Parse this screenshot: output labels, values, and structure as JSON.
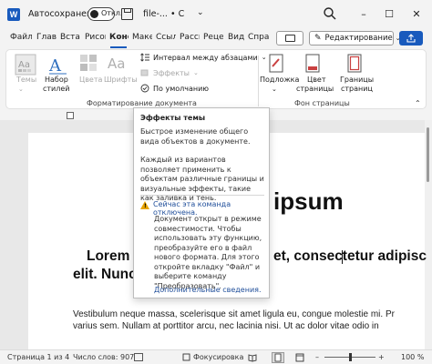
{
  "titlebar": {
    "autosave_label": "Автосохранение",
    "toggle_state": "Откл.",
    "file_title": "file-... • С",
    "title_chevron": "⌄",
    "minimize": "–",
    "maximize": "☐",
    "close": "✕"
  },
  "tabs": [
    {
      "label": "Файл"
    },
    {
      "label": "Главн"
    },
    {
      "label": "Вставк"
    },
    {
      "label": "Рисова"
    },
    {
      "label": "Конструктор"
    },
    {
      "label": "Макет"
    },
    {
      "label": "Ссылки"
    },
    {
      "label": "Рассылки"
    },
    {
      "label": "Рецензирование"
    },
    {
      "label": "Вид"
    },
    {
      "label": "Справка"
    }
  ],
  "editing_button": "Редактирование",
  "ribbon": {
    "themes_label": "Темы",
    "style_set_label_1": "Набор",
    "style_set_label_2": "стилей",
    "colors_label": "Цвета",
    "fonts_label": "Шрифты",
    "paragraph_spacing": "Интервал между абзацами",
    "effects": "Эффекты",
    "set_default": "По умолчанию",
    "group_doc_format": "Форматирование документа",
    "watermark_label": "Подложка",
    "page_color_1": "Цвет",
    "page_color_2": "страницы",
    "page_borders_1": "Границы",
    "page_borders_2": "страниц",
    "group_page_bg": "Фон страницы"
  },
  "tooltip": {
    "title": "Эффекты темы",
    "desc": "Быстрое изменение общего вида объектов в документе.",
    "desc2": "Каждый из вариантов позволяет применить к объектам различные границы и визуальные эффекты, такие как заливка и тень.",
    "warning_title": "Сейчас эта команда отключена.",
    "warning_text": "Документ открыт в режиме совместимости. Чтобы использовать эту функцию, преобразуйте его в файл нового формата. Для этого откройте вкладку \"Файл\" и выберите команду \"Преобразовать\".",
    "more_info": "Дополнительные сведения."
  },
  "document": {
    "heading_fragment": "ipsum",
    "lorem_start": "Lorem",
    "lorem_cont": "et, consectetur adipisc",
    "lorem_line2": "elit. Nunc",
    "body_line1": "Vestibulum neque massa, scelerisque sit amet ligula eu, congue molestie mi. Pr",
    "body_line2": "varius sem. Nullam at porttitor arcu, nec lacinia nisi. Ut ac dolor vitae odio in"
  },
  "statusbar": {
    "page_info": "Страница 1 из 4",
    "word_count": "Число слов: 907",
    "focus_label": "Фокусировка",
    "zoom_minus": "–",
    "zoom_plus": "+",
    "zoom_level": "100 %"
  }
}
